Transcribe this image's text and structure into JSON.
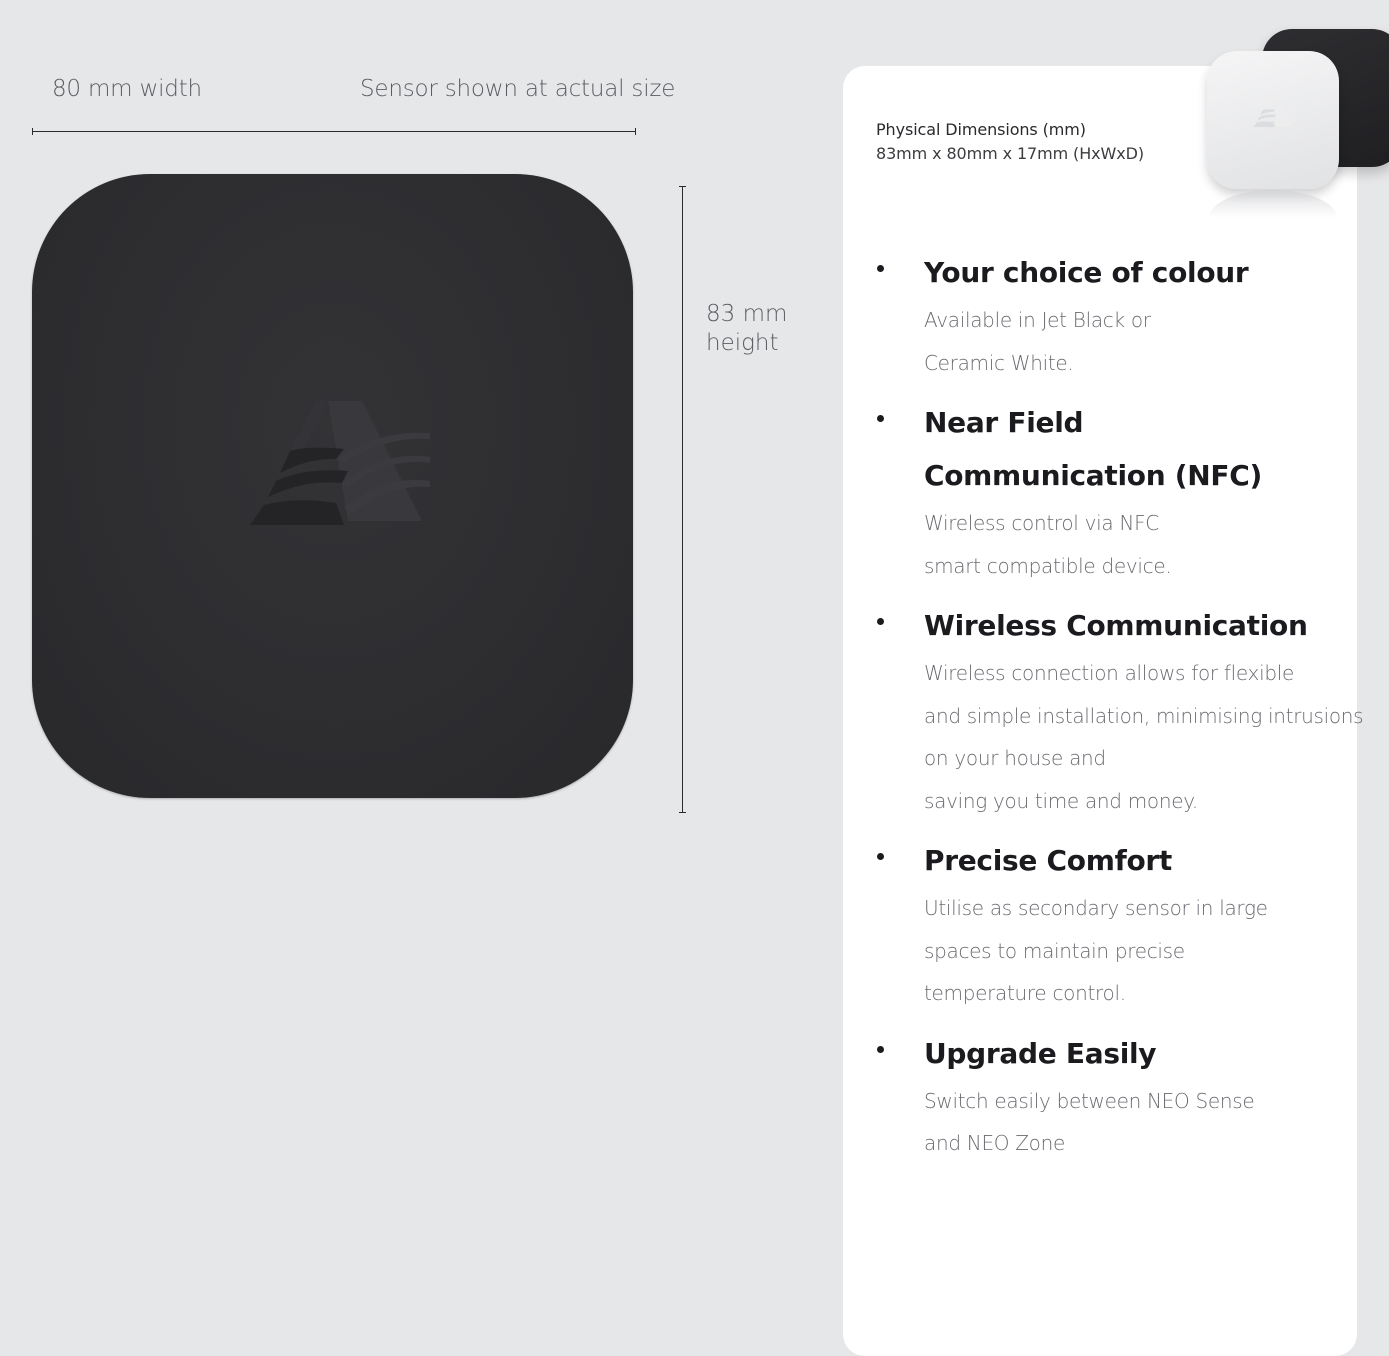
{
  "measurement": {
    "width_label": "80 mm width",
    "actual_size_label": "Sensor shown at actual size",
    "height_label_line1": "83 mm",
    "height_label_line2": "height"
  },
  "sensor": {
    "color": "#2e2e31",
    "logo_icon": "brand-logo-icon"
  },
  "dimensions": {
    "title": "Physical Dimensions (mm)",
    "value": "83mm x 80mm x 17mm (HxWxD)"
  },
  "variants": [
    {
      "name": "jet-black-sensor",
      "color": "#252528"
    },
    {
      "name": "ceramic-white-sensor",
      "color": "#eeeeef"
    }
  ],
  "features": [
    {
      "title_lines": [
        "Your choice of colour"
      ],
      "desc_lines": [
        "Available in Jet Black or",
        "Ceramic White."
      ]
    },
    {
      "title_lines": [
        "Near Field",
        "Communication (NFC)"
      ],
      "desc_lines": [
        "Wireless control via NFC",
        "smart compatible device."
      ]
    },
    {
      "title_lines": [
        "Wireless Communication"
      ],
      "desc_lines": [
        "Wireless connection allows for flexible",
        "and simple installation, minimising intrusions",
        "on your house and",
        "saving you time and money."
      ]
    },
    {
      "title_lines": [
        "Precise Comfort"
      ],
      "desc_lines": [
        "Utilise as secondary sensor in large",
        "spaces to maintain precise",
        "temperature control."
      ]
    },
    {
      "title_lines": [
        "Upgrade Easily"
      ],
      "desc_lines": [
        "Switch easily between NEO Sense",
        "and NEO Zone"
      ]
    }
  ]
}
